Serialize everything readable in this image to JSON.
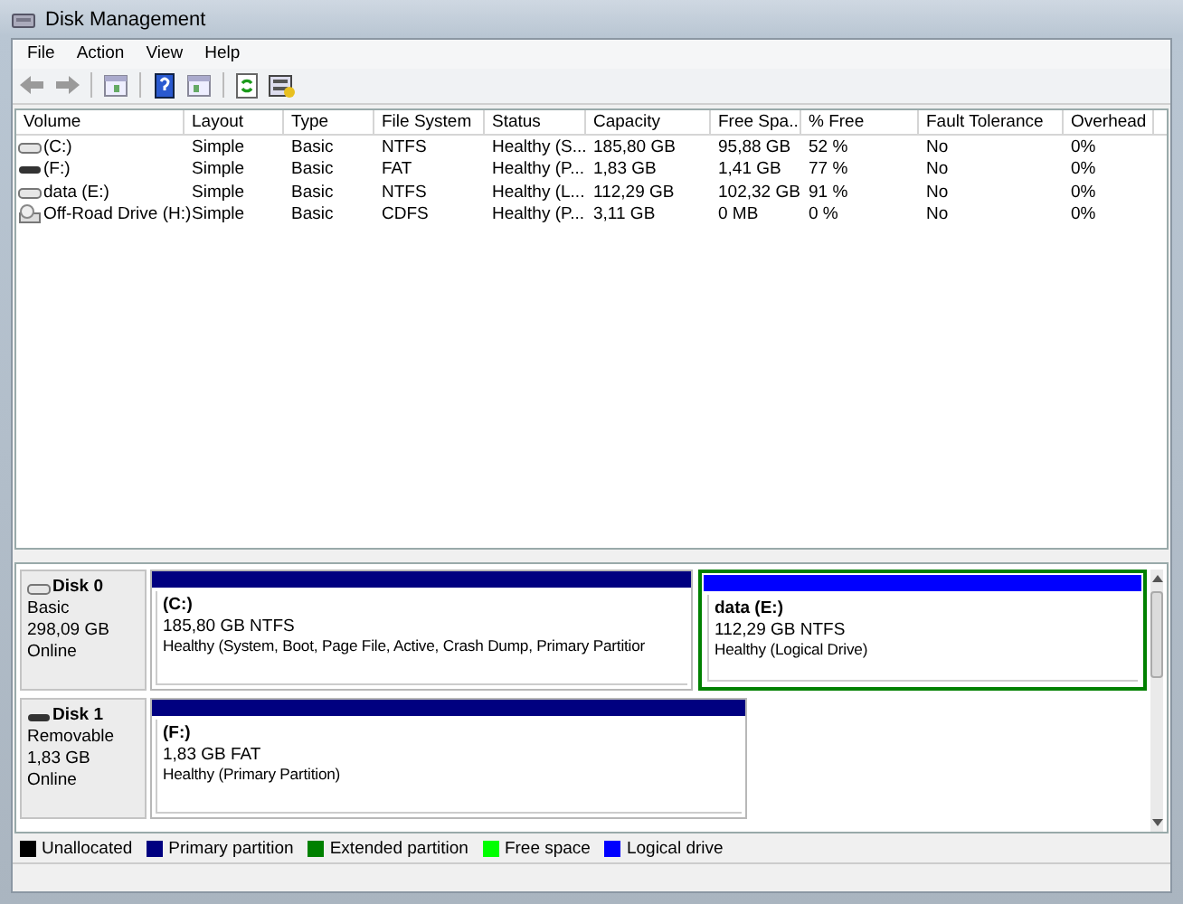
{
  "window": {
    "title": "Disk Management"
  },
  "menu": [
    "File",
    "Action",
    "View",
    "Help"
  ],
  "volume_list": {
    "columns": [
      "Volume",
      "Layout",
      "Type",
      "File System",
      "Status",
      "Capacity",
      "Free Spa...",
      "% Free",
      "Fault Tolerance",
      "Overhead"
    ],
    "rows": [
      {
        "kind": "hdd",
        "cells": [
          "(C:)",
          "Simple",
          "Basic",
          "NTFS",
          "Healthy (S...",
          "185,80 GB",
          "95,88 GB",
          "52 %",
          "No",
          "0%"
        ]
      },
      {
        "kind": "removable",
        "cells": [
          "(F:)",
          "Simple",
          "Basic",
          "FAT",
          "Healthy (P...",
          "1,83 GB",
          "1,41 GB",
          "77 %",
          "No",
          "0%"
        ]
      },
      {
        "kind": "hdd",
        "cells": [
          "data (E:)",
          "Simple",
          "Basic",
          "NTFS",
          "Healthy (L...",
          "112,29 GB",
          "102,32 GB",
          "91 %",
          "No",
          "0%"
        ]
      },
      {
        "kind": "cd",
        "cells": [
          "Off-Road Drive (H:)",
          "Simple",
          "Basic",
          "CDFS",
          "Healthy (P...",
          "3,11 GB",
          "0 MB",
          "0 %",
          "No",
          "0%"
        ]
      }
    ]
  },
  "disks": [
    {
      "kind": "hdd",
      "name": "Disk 0",
      "type": "Basic",
      "size": "298,09 GB",
      "state": "Online",
      "partitions": [
        {
          "kind": "primary",
          "name": "(C:)",
          "size": "185,80 GB NTFS",
          "status": "Healthy (System, Boot, Page File, Active, Crash Dump, Primary Partitior"
        },
        {
          "kind": "logical",
          "name": "data  (E:)",
          "size": "112,29 GB NTFS",
          "status": "Healthy (Logical Drive)"
        }
      ]
    },
    {
      "kind": "removable",
      "name": "Disk 1",
      "type": "Removable",
      "size": "1,83 GB",
      "state": "Online",
      "partitions": [
        {
          "kind": "primary",
          "name": "(F:)",
          "size": "1,83 GB FAT",
          "status": "Healthy (Primary Partition)"
        }
      ]
    }
  ],
  "legend": [
    {
      "label": "Unallocated",
      "color": "#000000"
    },
    {
      "label": "Primary partition",
      "color": "#000080"
    },
    {
      "label": "Extended partition",
      "color": "#008000"
    },
    {
      "label": "Free space",
      "color": "#00ff00"
    },
    {
      "label": "Logical drive",
      "color": "#0000ff"
    }
  ]
}
